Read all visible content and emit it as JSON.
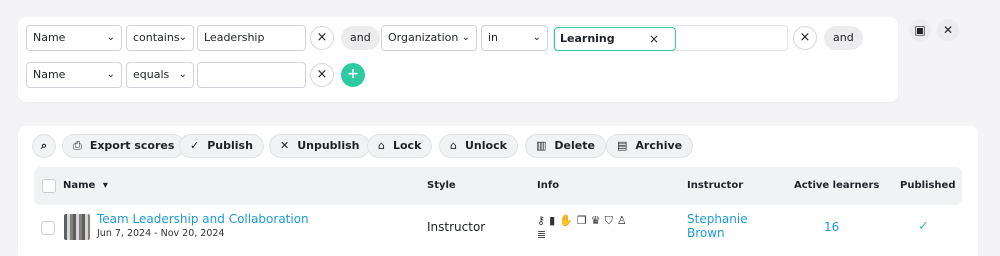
{
  "filters": {
    "row1": {
      "field": "Name",
      "operator": "contains",
      "value": "Leadership",
      "conjunction1": "and",
      "field2": "Organization",
      "operator2": "in",
      "token": "Learning",
      "conjunction2": "and"
    },
    "row2": {
      "field": "Name",
      "operator": "equals",
      "value": ""
    },
    "add_label": "+",
    "clear_label": "×"
  },
  "toolbar": {
    "export_label": "Export scores",
    "publish_label": "Publish",
    "unpublish_label": "Unpublish",
    "lock_label": "Lock",
    "unlock_label": "Unlock",
    "delete_label": "Delete",
    "archive_label": "Archive"
  },
  "table": {
    "headers": {
      "name": "Name",
      "style": "Style",
      "info": "Info",
      "instructor": "Instructor",
      "active_learners": "Active learners",
      "published": "Published"
    },
    "rows": [
      {
        "name": "Team Leadership and Collaboration",
        "dates": "Jun 7, 2024 - Nov 20, 2024",
        "style": "Instructor",
        "info_icons": [
          "key-icon",
          "bar-chart-icon",
          "hands-icon",
          "copy-icon",
          "trophy-icon",
          "shield-icon",
          "person-icon",
          "server-icon"
        ],
        "instructor_line1": "Stephanie",
        "instructor_line2": "Brown",
        "active_learners": "16",
        "published": "✓"
      }
    ]
  },
  "colors": {
    "accent": "#2ecba0",
    "link": "#1e9bd7"
  }
}
